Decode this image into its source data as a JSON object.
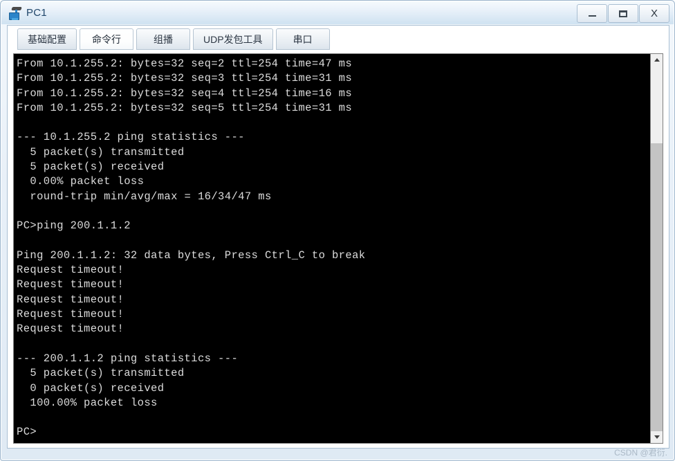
{
  "window": {
    "title": "PC1",
    "icon": "pc-terminal-icon",
    "controls": {
      "minimize_label": "–",
      "maximize_label": "❐",
      "close_label": "X"
    }
  },
  "tabs": [
    {
      "label": "基础配置",
      "active": false
    },
    {
      "label": "命令行",
      "active": true
    },
    {
      "label": "组播",
      "active": false
    },
    {
      "label": "UDP发包工具",
      "active": false
    },
    {
      "label": "串口",
      "active": false
    }
  ],
  "terminal": {
    "foreground": "#dcdcdc",
    "background": "#000000",
    "lines": [
      "From 10.1.255.2: bytes=32 seq=2 ttl=254 time=47 ms",
      "From 10.1.255.2: bytes=32 seq=3 ttl=254 time=31 ms",
      "From 10.1.255.2: bytes=32 seq=4 ttl=254 time=16 ms",
      "From 10.1.255.2: bytes=32 seq=5 ttl=254 time=31 ms",
      "",
      "--- 10.1.255.2 ping statistics ---",
      "  5 packet(s) transmitted",
      "  5 packet(s) received",
      "  0.00% packet loss",
      "  round-trip min/avg/max = 16/34/47 ms",
      "",
      "PC>ping 200.1.1.2",
      "",
      "Ping 200.1.1.2: 32 data bytes, Press Ctrl_C to break",
      "Request timeout!",
      "Request timeout!",
      "Request timeout!",
      "Request timeout!",
      "Request timeout!",
      "",
      "--- 200.1.1.2 ping statistics ---",
      "  5 packet(s) transmitted",
      "  0 packet(s) received",
      "  100.00% packet loss",
      "",
      "PC>"
    ]
  },
  "scrollbar": {
    "up_arrow": "chevron-up",
    "down_arrow": "chevron-down"
  },
  "watermark": {
    "text": "CSDN @君衍."
  }
}
